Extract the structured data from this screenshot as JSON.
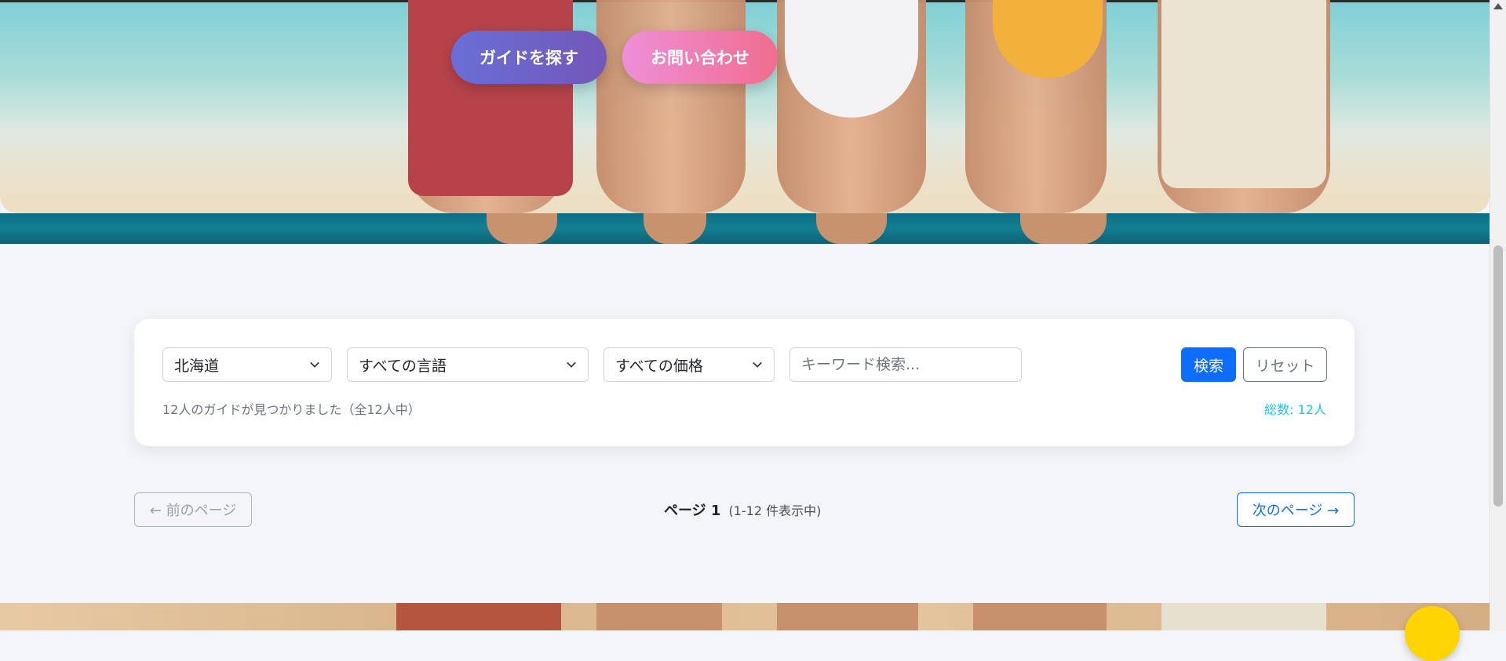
{
  "hero": {
    "find_guide_label": "ガイドを探す",
    "contact_label": "お問い合わせ"
  },
  "filters": {
    "region": {
      "selected": "北海道"
    },
    "language": {
      "selected": "すべての言語"
    },
    "price": {
      "selected": "すべての価格"
    },
    "keyword": {
      "value": "",
      "placeholder": "キーワード検索..."
    },
    "search_label": "検索",
    "reset_label": "リセット",
    "result_text": "12人のガイドが見つかりました（全12人中）",
    "total_text": "総数: 12人"
  },
  "pagination": {
    "prev_label": "← 前のページ",
    "page_label": "ページ 1",
    "range_label": "(1-12 件表示中)",
    "next_label": "次のページ →"
  },
  "colors": {
    "primary": "#0d6efd",
    "info": "#0dcaf0",
    "find_button": "#6a6fd6",
    "contact_button": "#f06d8e"
  },
  "icons": {
    "select_caret": "chevron-down-icon",
    "scroll_up": "scroll-up-arrow-icon"
  }
}
